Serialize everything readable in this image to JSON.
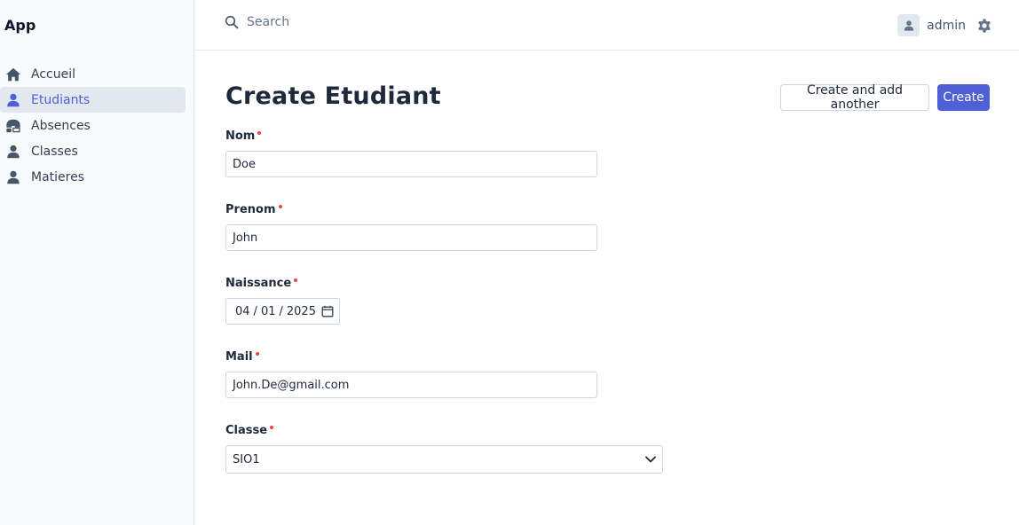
{
  "app": {
    "brand": "App"
  },
  "sidebar": {
    "items": [
      {
        "label": "Accueil",
        "icon": "home-icon",
        "active": false
      },
      {
        "label": "Etudiants",
        "icon": "user-icon",
        "active": true
      },
      {
        "label": "Absences",
        "icon": "absence-icon",
        "active": false
      },
      {
        "label": "Classes",
        "icon": "user-icon",
        "active": false
      },
      {
        "label": "Matieres",
        "icon": "user-icon",
        "active": false
      }
    ]
  },
  "topbar": {
    "search_placeholder": "Search",
    "username": "admin"
  },
  "page": {
    "title": "Create Etudiant",
    "create_another_label": "Create and add another",
    "create_label": "Create"
  },
  "form": {
    "nom": {
      "label": "Nom",
      "value": "Doe"
    },
    "prenom": {
      "label": "Prenom",
      "value": "John"
    },
    "naissance": {
      "label": "Naissance",
      "day": "04",
      "month": "01",
      "year": "2025",
      "sep": "/"
    },
    "mail": {
      "label": "Mail",
      "value": "John.De@gmail.com"
    },
    "classe": {
      "label": "Classe",
      "value": "SIO1"
    }
  },
  "colors": {
    "accent": "#4f5fd6",
    "required": "#ef4444",
    "sidebar_bg": "#f9fafb",
    "active_bg": "#e2e8f0",
    "icon": "#475569"
  }
}
